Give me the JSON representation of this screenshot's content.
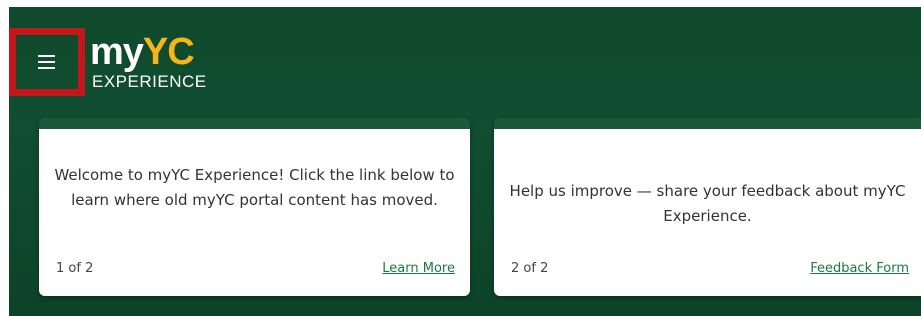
{
  "header": {
    "menu_icon": "hamburger-menu-icon",
    "logo": {
      "my": "my",
      "yc": "YC",
      "sub": "EXPERIENCE"
    },
    "accent_color": "#f5b61a",
    "highlight_color": "#c4171d"
  },
  "cards": [
    {
      "text": "Welcome to myYC Experience! Click the link below to learn where old myYC portal content has moved.",
      "count": "1 of 2",
      "link_label": "Learn More"
    },
    {
      "text": "Help us improve — share your feedback about myYC Experience.",
      "count": "2 of 2",
      "link_label": "Feedback Form"
    }
  ]
}
